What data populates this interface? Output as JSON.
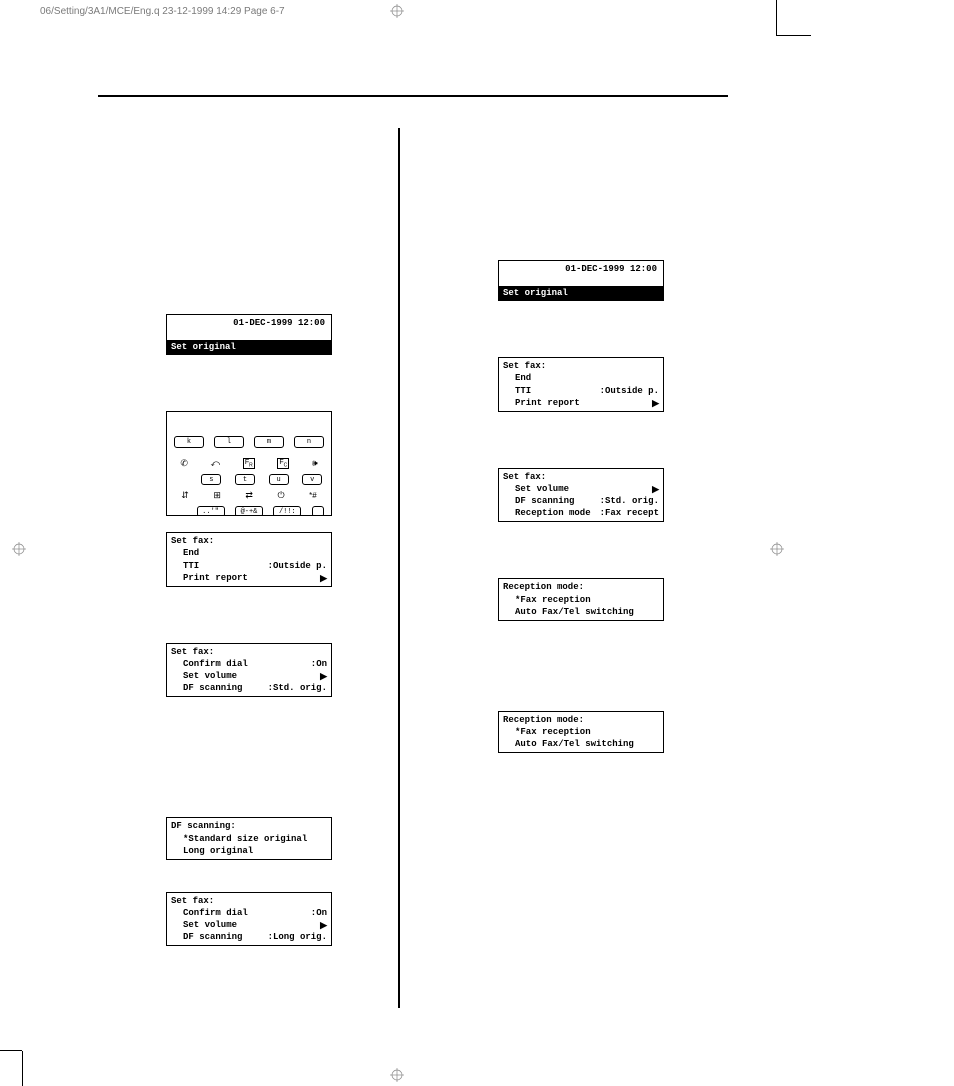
{
  "header": "06/Setting/3A1/MCE/Eng.q  23-12-1999 14:29  Page 6-7",
  "lcd_date": "01-DEC-1999 12:00",
  "set_original": "Set original",
  "left": {
    "fax1": {
      "title": "Set fax:",
      "r1": "End",
      "r2_label": "TTI",
      "r2_value": ":Outside p.",
      "r3": "Print report"
    },
    "fax2": {
      "title": "Set fax:",
      "r1_label": "Confirm dial",
      "r1_value": ":On",
      "r2": "Set volume",
      "r3_label": "DF scanning",
      "r3_value": ":Std. orig."
    },
    "dfscan": {
      "title": "DF scanning:",
      "r1": "*Standard size original",
      "r2": "Long original"
    },
    "fax3": {
      "title": "Set fax:",
      "r1_label": "Confirm dial",
      "r1_value": ":On",
      "r2": "Set volume",
      "r3_label": "DF scanning",
      "r3_value": ":Long orig."
    }
  },
  "right": {
    "fax1": {
      "title": "Set fax:",
      "r1": "End",
      "r2_label": "TTI",
      "r2_value": ":Outside p.",
      "r3": "Print report"
    },
    "fax2": {
      "title": "Set fax:",
      "r1": "Set volume",
      "r2_label": "DF scanning",
      "r2_value": ":Std. orig.",
      "r3_label": "Reception mode",
      "r3_value": ":Fax recept"
    },
    "rmode1": {
      "title": "Reception mode:",
      "r1": "*Fax reception",
      "r2": "Auto Fax/Tel switching"
    },
    "rmode2": {
      "title": "Reception mode:",
      "r1": "*Fax reception",
      "r2": "Auto Fax/Tel switching"
    }
  },
  "keypad": {
    "row1": [
      "k",
      "l",
      "m",
      "n"
    ],
    "row2_icons": [
      "phone-icon",
      "back-icon",
      "fr-icon",
      "fc-icon",
      "sound-icon"
    ],
    "row2": [
      "s",
      "t",
      "u",
      "v"
    ],
    "row3_icons": [
      "arrows-icon",
      "grid-icon",
      "swap-icon",
      "power-icon",
      "star-hash"
    ],
    "row3": [
      "..'\"",
      "@-+&",
      "/!!:"
    ]
  }
}
